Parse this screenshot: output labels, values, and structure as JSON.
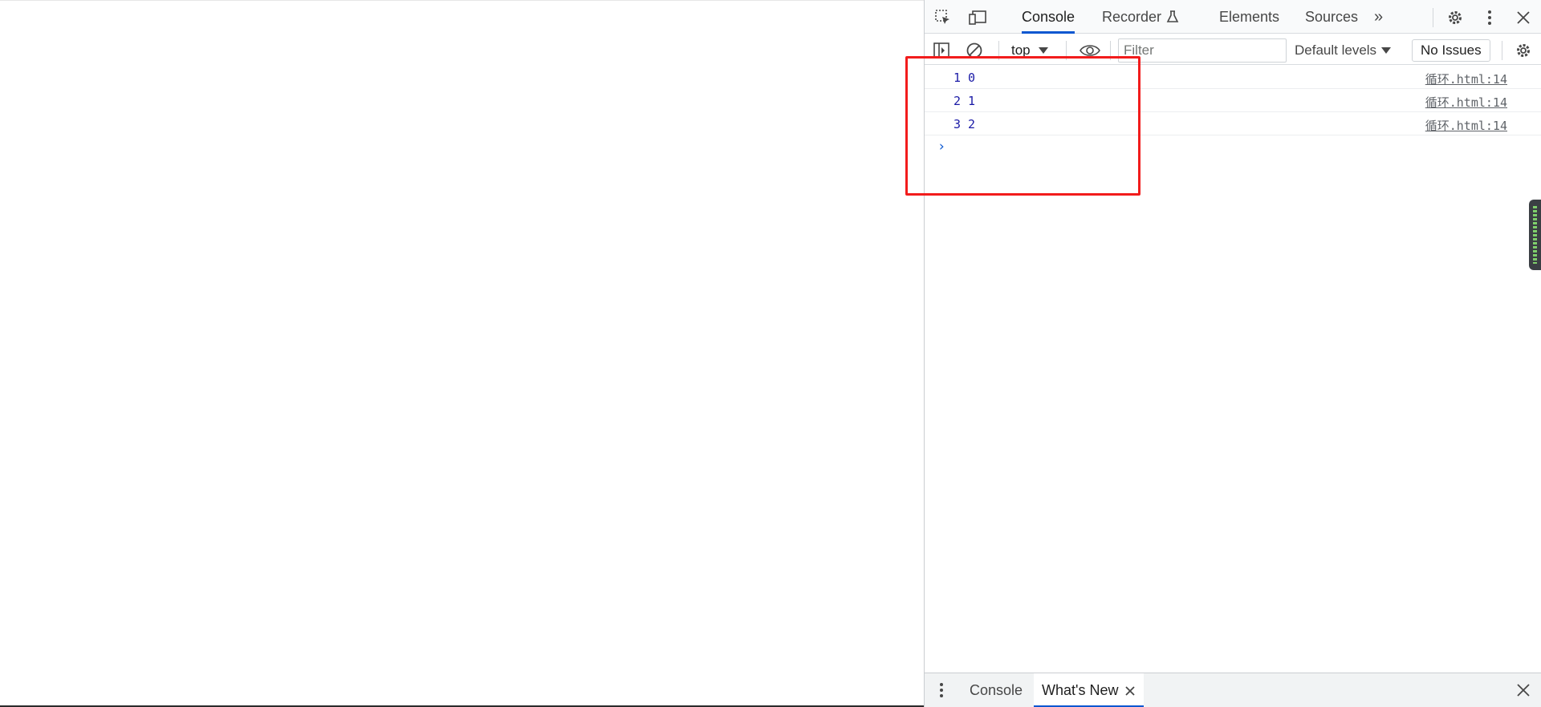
{
  "main_toolbar": {
    "inspect_icon": "inspect-element-icon",
    "device_icon": "device-toolbar-icon",
    "tabs": [
      {
        "label": "Console",
        "active": true
      },
      {
        "label": "Recorder",
        "icon": "flask-icon"
      },
      {
        "label": "Elements"
      },
      {
        "label": "Sources"
      }
    ],
    "more_tabs": "»",
    "settings_icon": "gear-icon",
    "menu_icon": "kebab-menu-icon",
    "close_icon": "close-icon"
  },
  "console_toolbar": {
    "sidebar_icon": "sidebar-toggle-icon",
    "clear_icon": "clear-console-icon",
    "context": "top",
    "live_expression_icon": "eye-icon",
    "filter_placeholder": "Filter",
    "filter_value": "",
    "levels": "Default levels",
    "issues": "No Issues",
    "settings_icon": "gear-icon"
  },
  "messages": [
    {
      "text": "1 0",
      "source": "循环.html:14"
    },
    {
      "text": "2 1",
      "source": "循环.html:14"
    },
    {
      "text": "3 2",
      "source": "循环.html:14"
    }
  ],
  "prompt": {
    "caret": "›",
    "value": ""
  },
  "drawer": {
    "menu_icon": "kebab-menu-icon",
    "tabs": [
      {
        "label": "Console",
        "active": false
      },
      {
        "label": "What's New",
        "active": true,
        "closable": true
      }
    ],
    "close_icon": "close-icon"
  },
  "colors": {
    "accent": "#0b57d0",
    "console_value": "#1a1aa6",
    "highlight": "#f21c1c"
  }
}
